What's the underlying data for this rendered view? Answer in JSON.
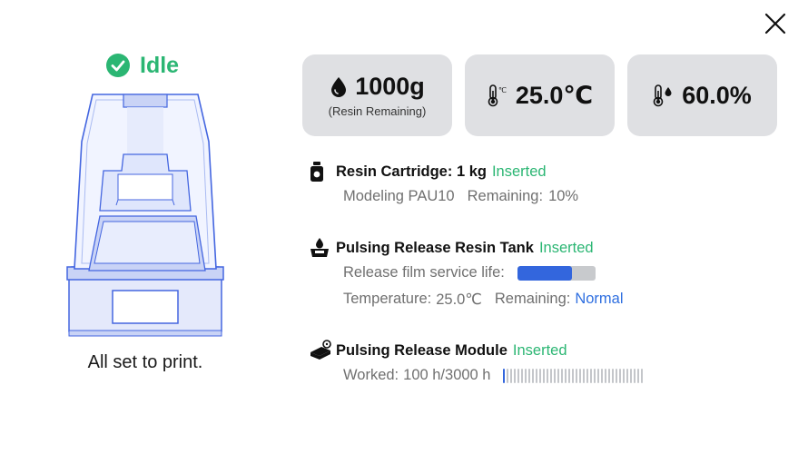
{
  "status": {
    "label": "Idle",
    "icon": "check-circle-icon",
    "color": "#2bb673"
  },
  "printer": {
    "caption": "All set to print."
  },
  "cards": [
    {
      "icon": "droplet-icon",
      "value": "1000g",
      "sub": "(Resin Remaining)"
    },
    {
      "icon": "thermometer-celsius-icon",
      "value": "25.0℃"
    },
    {
      "icon": "humidity-icon",
      "value": "60.0%"
    }
  ],
  "resin_cartridge": {
    "title": "Resin Cartridge: 1 kg",
    "status": "Inserted",
    "model": "Modeling PAU10",
    "remaining_label": "Remaining:",
    "remaining_value": "10%"
  },
  "resin_tank": {
    "title": "Pulsing Release Resin Tank",
    "status": "Inserted",
    "film_label": "Release film service life:",
    "film_life_fraction": 0.7,
    "temperature_label": "Temperature:",
    "temperature_value": "25.0℃",
    "remaining_label": "Remaining:",
    "remaining_value": "Normal"
  },
  "release_module": {
    "title": "Pulsing Release Module",
    "status": "Inserted",
    "worked_label": "Worked:",
    "worked_value": "100 h/3000 h",
    "worked_hours": 100,
    "total_hours": 3000
  },
  "colors": {
    "accent": "#3366dd",
    "success": "#2bb673",
    "link": "#2f6fe0",
    "card_bg": "#dfe0e3"
  }
}
